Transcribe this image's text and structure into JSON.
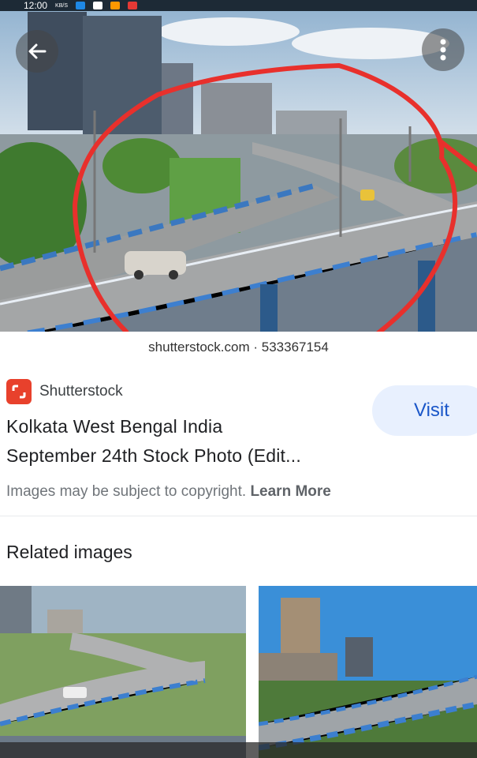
{
  "status_bar": {
    "time": "12:00",
    "speed": "KB/S"
  },
  "hero_image": {
    "watermark": "shutterstock.com · 533367154",
    "annotation_color": "#e8302c"
  },
  "source": {
    "name": "Shutterstock",
    "logo_color": "#e8412c"
  },
  "result": {
    "title_line1": "Kolkata West Bengal India",
    "title_line2": "September 24th Stock Photo (Edit..."
  },
  "visit_button": {
    "label": "Visit"
  },
  "copyright": {
    "text": "Images may be subject to copyright.",
    "link": "Learn More"
  },
  "related": {
    "heading": "Related images"
  }
}
